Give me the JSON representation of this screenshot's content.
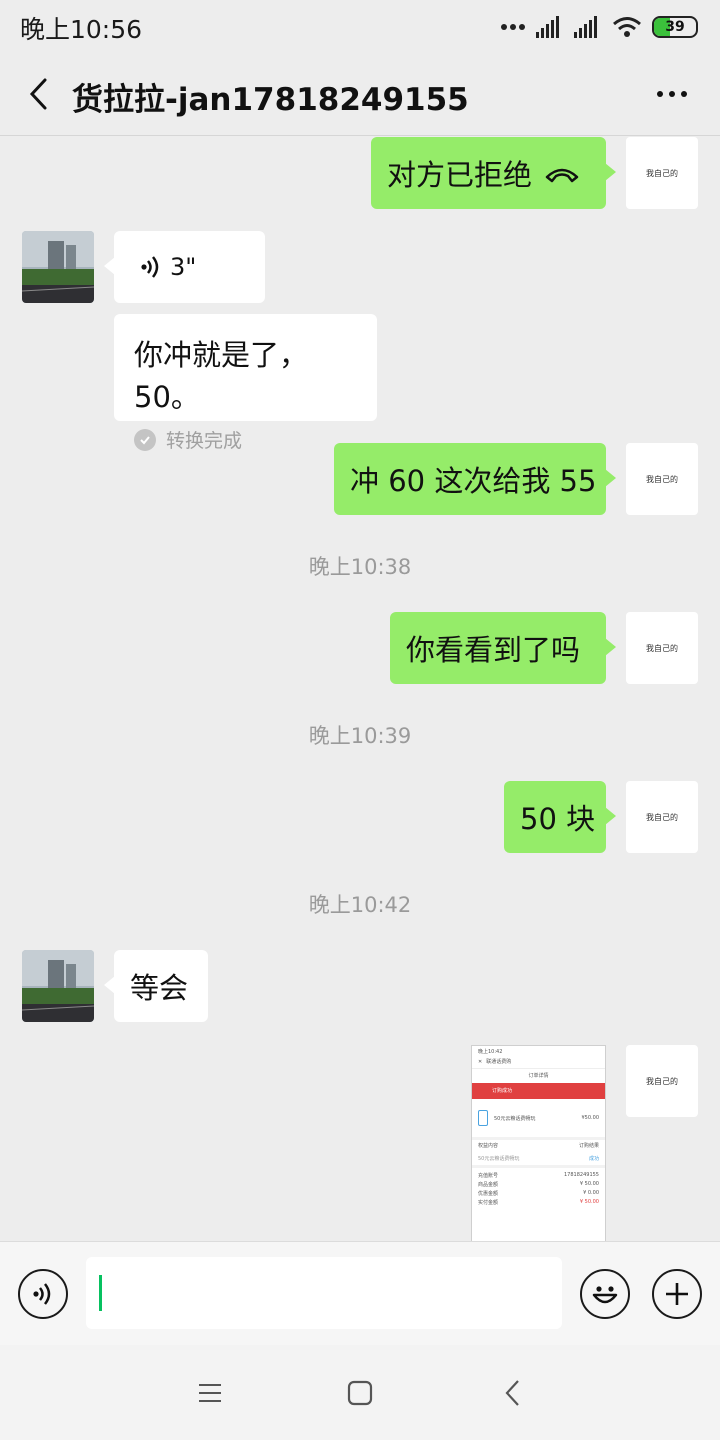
{
  "status_bar": {
    "time": "晚上10:56",
    "battery": "39",
    "battery_level": 0.39
  },
  "header": {
    "title": "货拉拉-jan17818249155",
    "back_icon": "chevron-left-icon",
    "more_icon": "more-dots-icon"
  },
  "self_avatar_text": "我自己的",
  "messages": {
    "call_rejected": "对方已拒绝",
    "voice_duration": "3\"",
    "voice_transcript": "你冲就是了，50。",
    "transcript_status": "转换完成",
    "msg_charge": "冲 60 这次给我 55",
    "time_1": "晚上10:38",
    "msg_seen": "你看看到了吗",
    "time_2": "晚上10:39",
    "msg_50": "50 块",
    "time_3": "晚上10:42",
    "msg_wait": "等会"
  },
  "screenshot_thumbnail": {
    "status_time": "晚上10:42",
    "app_title": "联通话费购",
    "page_title": "订单详情",
    "banner": "订购成功",
    "product": "50元云粮话费畅玩",
    "product_price": "¥50.00",
    "left_label": "权益内容",
    "right_label": "订购结果",
    "detail_line": "50元云粮话费畅玩",
    "detail_status": "成功",
    "rows": [
      {
        "label": "充值账号",
        "value": "17818249155"
      },
      {
        "label": "商品金额",
        "value": "¥ 50.00"
      },
      {
        "label": "优惠金额",
        "value": "¥ 0.00"
      },
      {
        "label": "实付金额",
        "value": "¥ 50.00"
      }
    ]
  },
  "input_bar": {
    "voice_icon": "voice-icon",
    "emoji_icon": "emoji-icon",
    "add_icon": "plus-circle-icon"
  },
  "nav_bar": {
    "menu_icon": "menu-icon",
    "home_icon": "home-square-icon",
    "back_icon": "back-triangle-icon"
  },
  "colors": {
    "sent_bubble": "#95ec69",
    "background": "#ededed",
    "caret": "#07c160",
    "banner_red": "#e04040"
  }
}
